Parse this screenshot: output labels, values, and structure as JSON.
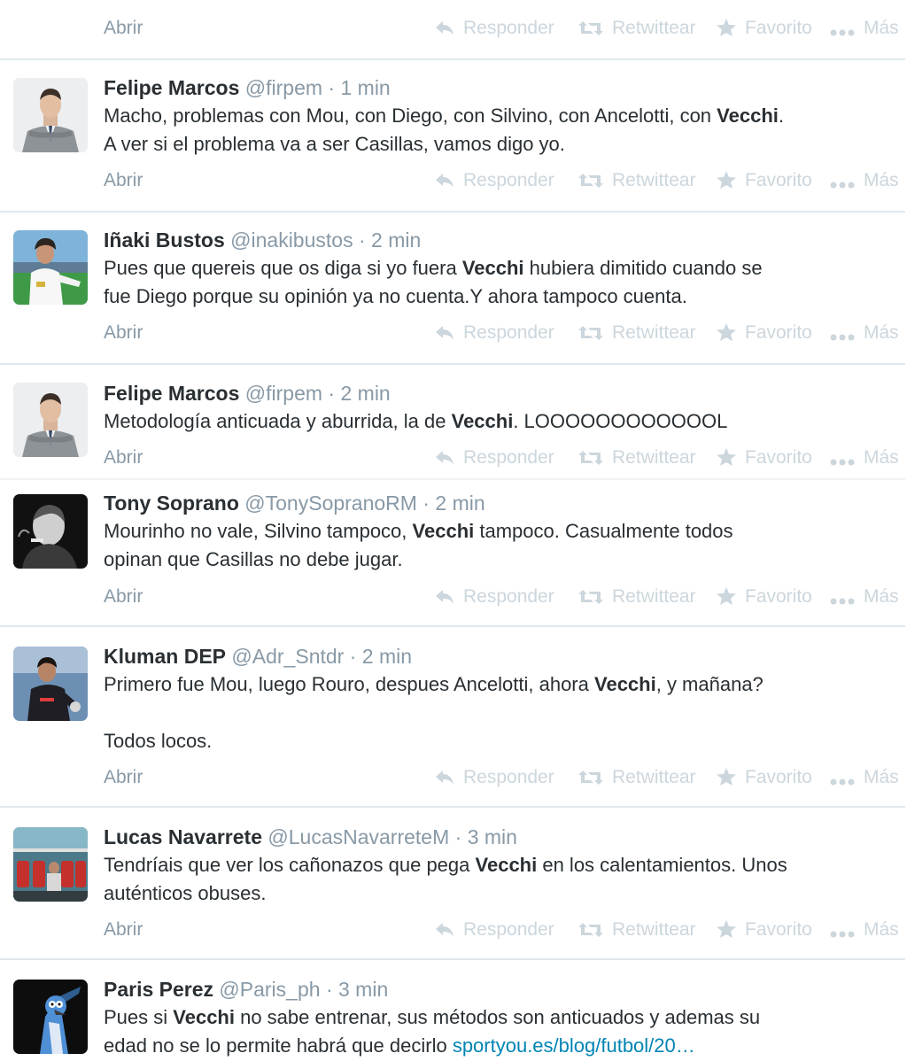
{
  "colors": {
    "name": "#292f33",
    "meta": "#8899a6",
    "action": "#ccd6dd",
    "link": "#0084b4",
    "divider": "#e1e8ed"
  },
  "actions": {
    "open": "Abrir",
    "reply": "Responder",
    "retweet": "Retwittear",
    "favorite": "Favorito",
    "more": "Más"
  },
  "tweets": [
    {
      "avatar": "avatar-partial",
      "text_lines": []
    },
    {
      "name": "Felipe Marcos",
      "handle": "@firpem",
      "time": "1 min",
      "avatar": "man-in-suit",
      "text_lines": [
        {
          "before": "Macho, problemas con Mou, con Diego, con Silvino, con Ancelotti, con ",
          "bold": "Vecchi",
          "after": "."
        },
        {
          "before": "A ver si el problema va a ser Casillas, vamos digo yo.",
          "bold": "",
          "after": ""
        }
      ]
    },
    {
      "name": "Iñaki Bustos",
      "handle": "@inakibustos",
      "time": "2 min",
      "avatar": "footballer-white-kit",
      "text_lines": [
        {
          "before": "Pues que quereis que os diga si yo fuera ",
          "bold": "Vecchi",
          "after": " hubiera dimitido cuando se"
        },
        {
          "before": "fue Diego porque su opinión ya no cuenta.Y ahora tampoco cuenta.",
          "bold": "",
          "after": ""
        }
      ]
    },
    {
      "name": "Felipe Marcos",
      "handle": "@firpem",
      "time": "2 min",
      "avatar": "man-in-suit",
      "text_lines": [
        {
          "before": "Metodología anticuada y aburrida, la de ",
          "bold": "Vecchi",
          "after": ". LOOOOOOOOOOOOL"
        }
      ]
    },
    {
      "name": "Tony Soprano",
      "handle": "@TonySopranoRM",
      "time": "2 min",
      "avatar": "dark-portrait",
      "text_lines": [
        {
          "before": "Mourinho no vale, Silvino tampoco, ",
          "bold": "Vecchi",
          "after": " tampoco. Casualmente todos"
        },
        {
          "before": "opinan que Casillas no debe jugar.",
          "bold": "",
          "after": ""
        }
      ]
    },
    {
      "name": "Kluman DEP",
      "handle": "@Adr_Sntdr",
      "time": "2 min",
      "avatar": "goalkeeper",
      "text_lines": [
        {
          "before": "Primero fue Mou, luego Rouro, despues Ancelotti, ahora ",
          "bold": "Vecchi",
          "after": ", y mañana?"
        },
        {
          "before": "",
          "bold": "",
          "after": ""
        },
        {
          "before": "Todos locos.",
          "bold": "",
          "after": ""
        }
      ]
    },
    {
      "name": "Lucas Navarrete",
      "handle": "@LucasNavarreteM",
      "time": "3 min",
      "avatar": "stadium-bench",
      "text_lines": [
        {
          "before": "Tendríais que ver los cañonazos que pega ",
          "bold": "Vecchi",
          "after": " en los calentamientos. Unos"
        },
        {
          "before": "auténticos obuses.",
          "bold": "",
          "after": ""
        }
      ]
    },
    {
      "name": "Paris Perez",
      "handle": "@Paris_ph",
      "time": "3 min",
      "avatar": "cartoon-bird",
      "text_lines": [
        {
          "before": "Pues si ",
          "bold": "Vecchi",
          "after": " no sabe entrenar, sus métodos son anticuados y ademas su"
        },
        {
          "before": "edad no se lo permite habrá que decirlo ",
          "bold": "",
          "after": "",
          "link": "sportyou.es/blog/futbol/20…"
        }
      ]
    }
  ]
}
